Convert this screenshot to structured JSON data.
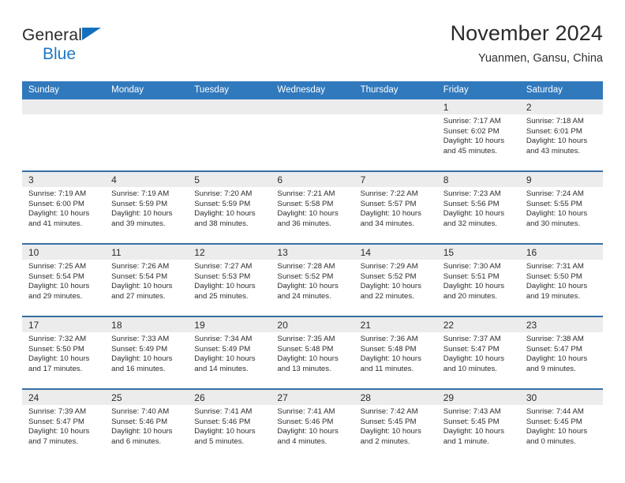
{
  "brand": {
    "name_top": "General",
    "name_bottom": "Blue",
    "triangle_color": "#1170bd",
    "blue_text_color": "#2077c4"
  },
  "header": {
    "title": "November 2024",
    "subtitle": "Yuanmen, Gansu, China",
    "header_bg": "#3179bd",
    "row_divider_color": "#376fa3",
    "daynum_band_bg": "#ececec"
  },
  "calendar": {
    "weekday_headers": [
      "Sunday",
      "Monday",
      "Tuesday",
      "Wednesday",
      "Thursday",
      "Friday",
      "Saturday"
    ],
    "weeks": [
      [
        {
          "day": "",
          "sunrise": "",
          "sunset": "",
          "daylight_line1": "",
          "daylight_line2": ""
        },
        {
          "day": "",
          "sunrise": "",
          "sunset": "",
          "daylight_line1": "",
          "daylight_line2": ""
        },
        {
          "day": "",
          "sunrise": "",
          "sunset": "",
          "daylight_line1": "",
          "daylight_line2": ""
        },
        {
          "day": "",
          "sunrise": "",
          "sunset": "",
          "daylight_line1": "",
          "daylight_line2": ""
        },
        {
          "day": "",
          "sunrise": "",
          "sunset": "",
          "daylight_line1": "",
          "daylight_line2": ""
        },
        {
          "day": "1",
          "sunrise": "Sunrise: 7:17 AM",
          "sunset": "Sunset: 6:02 PM",
          "daylight_line1": "Daylight: 10 hours",
          "daylight_line2": "and 45 minutes."
        },
        {
          "day": "2",
          "sunrise": "Sunrise: 7:18 AM",
          "sunset": "Sunset: 6:01 PM",
          "daylight_line1": "Daylight: 10 hours",
          "daylight_line2": "and 43 minutes."
        }
      ],
      [
        {
          "day": "3",
          "sunrise": "Sunrise: 7:19 AM",
          "sunset": "Sunset: 6:00 PM",
          "daylight_line1": "Daylight: 10 hours",
          "daylight_line2": "and 41 minutes."
        },
        {
          "day": "4",
          "sunrise": "Sunrise: 7:19 AM",
          "sunset": "Sunset: 5:59 PM",
          "daylight_line1": "Daylight: 10 hours",
          "daylight_line2": "and 39 minutes."
        },
        {
          "day": "5",
          "sunrise": "Sunrise: 7:20 AM",
          "sunset": "Sunset: 5:59 PM",
          "daylight_line1": "Daylight: 10 hours",
          "daylight_line2": "and 38 minutes."
        },
        {
          "day": "6",
          "sunrise": "Sunrise: 7:21 AM",
          "sunset": "Sunset: 5:58 PM",
          "daylight_line1": "Daylight: 10 hours",
          "daylight_line2": "and 36 minutes."
        },
        {
          "day": "7",
          "sunrise": "Sunrise: 7:22 AM",
          "sunset": "Sunset: 5:57 PM",
          "daylight_line1": "Daylight: 10 hours",
          "daylight_line2": "and 34 minutes."
        },
        {
          "day": "8",
          "sunrise": "Sunrise: 7:23 AM",
          "sunset": "Sunset: 5:56 PM",
          "daylight_line1": "Daylight: 10 hours",
          "daylight_line2": "and 32 minutes."
        },
        {
          "day": "9",
          "sunrise": "Sunrise: 7:24 AM",
          "sunset": "Sunset: 5:55 PM",
          "daylight_line1": "Daylight: 10 hours",
          "daylight_line2": "and 30 minutes."
        }
      ],
      [
        {
          "day": "10",
          "sunrise": "Sunrise: 7:25 AM",
          "sunset": "Sunset: 5:54 PM",
          "daylight_line1": "Daylight: 10 hours",
          "daylight_line2": "and 29 minutes."
        },
        {
          "day": "11",
          "sunrise": "Sunrise: 7:26 AM",
          "sunset": "Sunset: 5:54 PM",
          "daylight_line1": "Daylight: 10 hours",
          "daylight_line2": "and 27 minutes."
        },
        {
          "day": "12",
          "sunrise": "Sunrise: 7:27 AM",
          "sunset": "Sunset: 5:53 PM",
          "daylight_line1": "Daylight: 10 hours",
          "daylight_line2": "and 25 minutes."
        },
        {
          "day": "13",
          "sunrise": "Sunrise: 7:28 AM",
          "sunset": "Sunset: 5:52 PM",
          "daylight_line1": "Daylight: 10 hours",
          "daylight_line2": "and 24 minutes."
        },
        {
          "day": "14",
          "sunrise": "Sunrise: 7:29 AM",
          "sunset": "Sunset: 5:52 PM",
          "daylight_line1": "Daylight: 10 hours",
          "daylight_line2": "and 22 minutes."
        },
        {
          "day": "15",
          "sunrise": "Sunrise: 7:30 AM",
          "sunset": "Sunset: 5:51 PM",
          "daylight_line1": "Daylight: 10 hours",
          "daylight_line2": "and 20 minutes."
        },
        {
          "day": "16",
          "sunrise": "Sunrise: 7:31 AM",
          "sunset": "Sunset: 5:50 PM",
          "daylight_line1": "Daylight: 10 hours",
          "daylight_line2": "and 19 minutes."
        }
      ],
      [
        {
          "day": "17",
          "sunrise": "Sunrise: 7:32 AM",
          "sunset": "Sunset: 5:50 PM",
          "daylight_line1": "Daylight: 10 hours",
          "daylight_line2": "and 17 minutes."
        },
        {
          "day": "18",
          "sunrise": "Sunrise: 7:33 AM",
          "sunset": "Sunset: 5:49 PM",
          "daylight_line1": "Daylight: 10 hours",
          "daylight_line2": "and 16 minutes."
        },
        {
          "day": "19",
          "sunrise": "Sunrise: 7:34 AM",
          "sunset": "Sunset: 5:49 PM",
          "daylight_line1": "Daylight: 10 hours",
          "daylight_line2": "and 14 minutes."
        },
        {
          "day": "20",
          "sunrise": "Sunrise: 7:35 AM",
          "sunset": "Sunset: 5:48 PM",
          "daylight_line1": "Daylight: 10 hours",
          "daylight_line2": "and 13 minutes."
        },
        {
          "day": "21",
          "sunrise": "Sunrise: 7:36 AM",
          "sunset": "Sunset: 5:48 PM",
          "daylight_line1": "Daylight: 10 hours",
          "daylight_line2": "and 11 minutes."
        },
        {
          "day": "22",
          "sunrise": "Sunrise: 7:37 AM",
          "sunset": "Sunset: 5:47 PM",
          "daylight_line1": "Daylight: 10 hours",
          "daylight_line2": "and 10 minutes."
        },
        {
          "day": "23",
          "sunrise": "Sunrise: 7:38 AM",
          "sunset": "Sunset: 5:47 PM",
          "daylight_line1": "Daylight: 10 hours",
          "daylight_line2": "and 9 minutes."
        }
      ],
      [
        {
          "day": "24",
          "sunrise": "Sunrise: 7:39 AM",
          "sunset": "Sunset: 5:47 PM",
          "daylight_line1": "Daylight: 10 hours",
          "daylight_line2": "and 7 minutes."
        },
        {
          "day": "25",
          "sunrise": "Sunrise: 7:40 AM",
          "sunset": "Sunset: 5:46 PM",
          "daylight_line1": "Daylight: 10 hours",
          "daylight_line2": "and 6 minutes."
        },
        {
          "day": "26",
          "sunrise": "Sunrise: 7:41 AM",
          "sunset": "Sunset: 5:46 PM",
          "daylight_line1": "Daylight: 10 hours",
          "daylight_line2": "and 5 minutes."
        },
        {
          "day": "27",
          "sunrise": "Sunrise: 7:41 AM",
          "sunset": "Sunset: 5:46 PM",
          "daylight_line1": "Daylight: 10 hours",
          "daylight_line2": "and 4 minutes."
        },
        {
          "day": "28",
          "sunrise": "Sunrise: 7:42 AM",
          "sunset": "Sunset: 5:45 PM",
          "daylight_line1": "Daylight: 10 hours",
          "daylight_line2": "and 2 minutes."
        },
        {
          "day": "29",
          "sunrise": "Sunrise: 7:43 AM",
          "sunset": "Sunset: 5:45 PM",
          "daylight_line1": "Daylight: 10 hours",
          "daylight_line2": "and 1 minute."
        },
        {
          "day": "30",
          "sunrise": "Sunrise: 7:44 AM",
          "sunset": "Sunset: 5:45 PM",
          "daylight_line1": "Daylight: 10 hours",
          "daylight_line2": "and 0 minutes."
        }
      ]
    ]
  }
}
